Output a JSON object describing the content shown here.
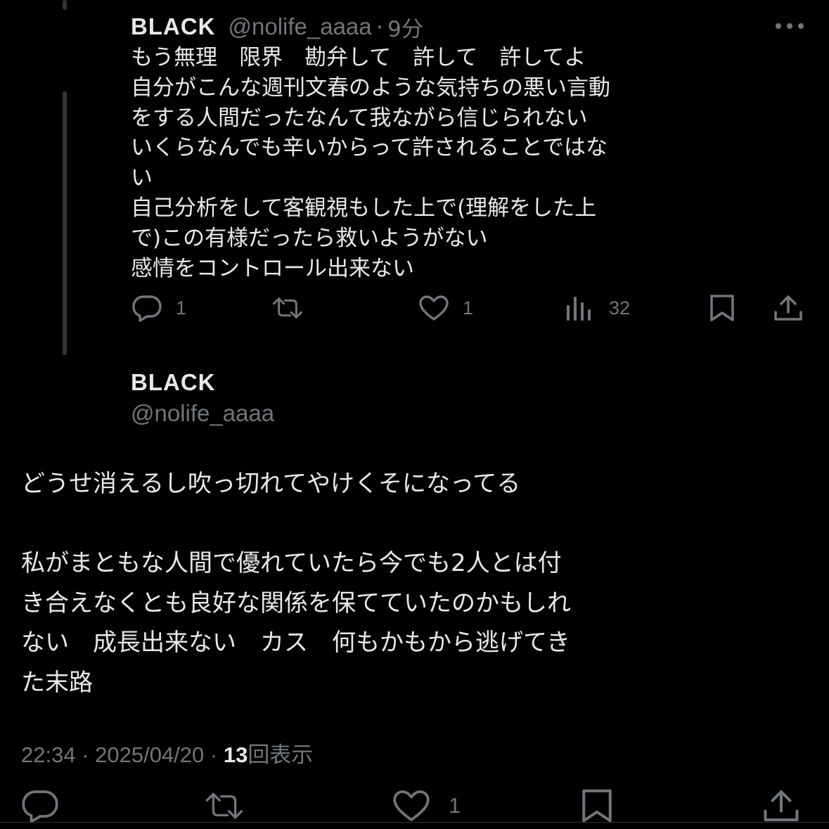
{
  "previous_tweet": {
    "display_name": "BLACK",
    "handle": "@nolife_aaaa",
    "separator": "·",
    "time_ago": "9分",
    "lines": [
      "もう無理　限界　勘弁して　許して　許してよ",
      "自分がこんな週刊文春のような気持ちの悪い言動",
      "をする人間だったなんて我ながら信じられない",
      "いくらなんでも辛いからって許されることではな",
      "い",
      "自己分析をして客観視もした上で(理解をした上",
      "で)この有様だったら救いようがない",
      "感情をコントロール出来ない"
    ],
    "actions": {
      "reply_icon": "reply-icon",
      "reply_count": "1",
      "retweet_icon": "retweet-icon",
      "like_icon": "heart-icon",
      "like_count": "1",
      "views_icon": "analytics-icon",
      "views_count": "32",
      "bookmark_icon": "bookmark-icon",
      "share_icon": "share-icon"
    },
    "more_icon": "more-horizontal-icon"
  },
  "main_tweet": {
    "display_name": "BLACK",
    "handle": "@nolife_aaaa",
    "lines": [
      "どうせ消えるし吹っ切れてやけくそになってる",
      "",
      "私がまともな人間で優れていたら今でも2人とは付",
      "き合えなくとも良好な関係を保てていたのかもしれ",
      "ない　成長出来ない　カス　何もかもから逃げてき",
      "た末路"
    ],
    "timestamp": "22:34 · 2025/04/20 · ",
    "views_count": "13",
    "views_label": "回表示",
    "actions": {
      "like_count": "1"
    }
  },
  "colors": {
    "background": "#000000",
    "text_primary": "#e7e9ea",
    "text_secondary": "#71767b",
    "thread_line": "#333639"
  }
}
